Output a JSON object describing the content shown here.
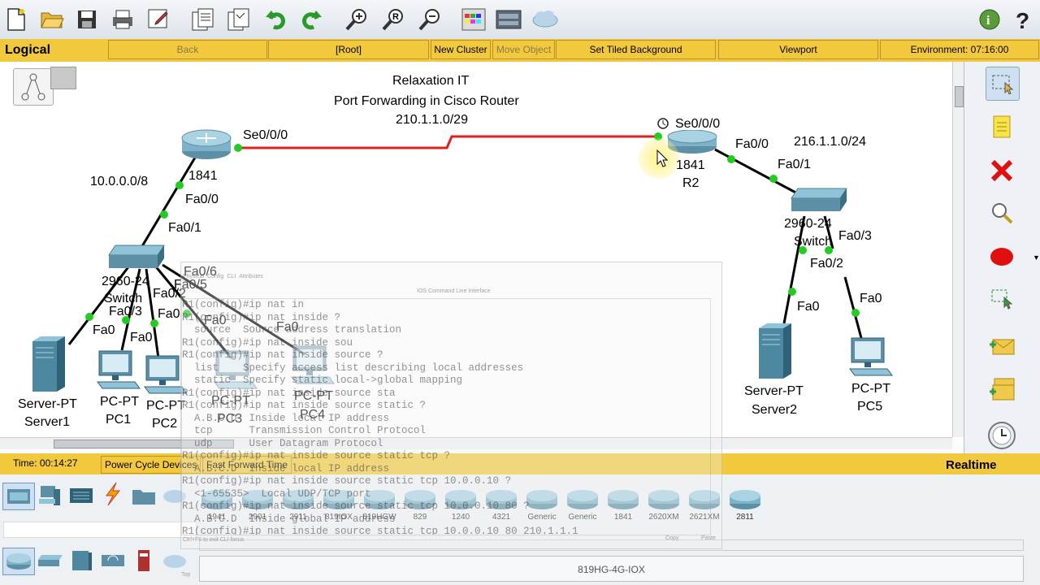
{
  "toolbar": {
    "icons": [
      "new-file-icon",
      "open-folder-icon",
      "save-icon",
      "print-icon",
      "edit-icon",
      "copy-icon",
      "paste-icon",
      "undo-icon",
      "redo-icon",
      "zoom-in-icon",
      "zoom-reset-icon",
      "zoom-out-icon",
      "palette-icon",
      "device-icon",
      "cloud-icon",
      "info-icon",
      "help-icon"
    ]
  },
  "logical_bar": {
    "label": "Logical",
    "back": "Back",
    "root": "[Root]",
    "new_cluster": "New Cluster",
    "move_object": "Move Object",
    "set_tiled_background": "Set Tiled Background",
    "viewport": "Viewport",
    "environment": "Environment: 07:16:00"
  },
  "canvas": {
    "title1": "Relaxation IT",
    "title2": "Port Forwarding in Cisco Router",
    "wan_net": "210.1.1.0/29",
    "left_net": "10.0.0.0/8",
    "right_net": "216.1.1.0/24",
    "r1_model": "1841",
    "r2_model": "1841",
    "r2_name": "R2",
    "sw1_model": "2960-24",
    "sw1_name": "Switch",
    "sw2_model": "2960-24",
    "sw2_name": "Switch",
    "ports": {
      "r1_se": "Se0/0/0",
      "r2_se": "Se0/0/0",
      "r1_fa": "Fa0/0",
      "sw1_up": "Fa0/1",
      "sw1_fa6": "Fa0/6",
      "sw1_fa5": "Fa0/5",
      "sw1_fa2": "Fa0/2",
      "sw1_fa3": "Fa0/3",
      "server1_fa": "Fa0",
      "pc1_fa": "Fa0",
      "pc2_fa": "Fa0",
      "pc3_fa": "Fa0",
      "pc4_fa": "Fa0",
      "r2_fa": "Fa0/0",
      "sw2_up": "Fa0/1",
      "sw2_fa2": "Fa0/2",
      "sw2_fa3": "Fa0/3",
      "server2_fa": "Fa0",
      "pc5_fa": "Fa0"
    },
    "devices": {
      "server1_type": "Server-PT",
      "server1_name": "Server1",
      "pc1_type": "PC-PT",
      "pc1_name": "PC1",
      "pc2_type": "PC-PT",
      "pc2_name": "PC2",
      "pc3_type": "PC-PT",
      "pc3_name": "PC3",
      "pc4_type": "PC-PT",
      "pc4_name": "PC4",
      "server2_type": "Server-PT",
      "server2_name": "Server2",
      "pc5_type": "PC-PT",
      "pc5_name": "PC5"
    }
  },
  "cli": {
    "title": "IOS Command Line Interface",
    "tabs": [
      "Physical",
      "Config",
      "CLI",
      "Attributes"
    ],
    "lines": [
      "R1(config)#ip nat in",
      "R1(config)#ip nat inside ?",
      "  source  Source address translation",
      "R1(config)#ip nat inside sou",
      "R1(config)#ip nat inside source ?",
      "  list    Specify access list describing local addresses",
      "  static  Specify static local->global mapping",
      "R1(config)#ip nat inside source sta",
      "R1(config)#ip nat inside source static ?",
      "  A.B.C.D  Inside local IP address",
      "  tcp      Transmission Control Protocol",
      "  udp      User Datagram Protocol",
      "R1(config)#ip nat inside source static tcp ?",
      "  A.B.C.D  Inside local IP address",
      "R1(config)#ip nat inside source static tcp 10.0.0.10 ?",
      "  <1-65535>  Local UDP/TCP port",
      "R1(config)#ip nat inside source static tcp 10.0.0.10 80 ?",
      "  A.B.C.D  Inside global IP address",
      "R1(config)#ip nat inside source static tcp 10.0.0.10 80 210.1.1.1"
    ],
    "hint": "Ctrl+F6 to exit CLI focus",
    "copy": "Copy",
    "paste": "Paste",
    "top": "Top"
  },
  "timebar": {
    "time": "Time: 00:14:27",
    "power_cycle": "Power Cycle Devices",
    "fast_forward": "Fast Forward Time",
    "mode": "Realtime"
  },
  "palette": {
    "devices": [
      "1941",
      "2901",
      "2911",
      "819IOX",
      "819HGW",
      "829",
      "1240",
      "4321",
      "Generic",
      "Generic",
      "1841",
      "2620XM",
      "2621XM",
      "2811"
    ],
    "description": "819HG-4G-IOX"
  },
  "colors": {
    "accent": "#f2c93c",
    "serial_link": "#e02020",
    "link_up": "#22cc22"
  }
}
